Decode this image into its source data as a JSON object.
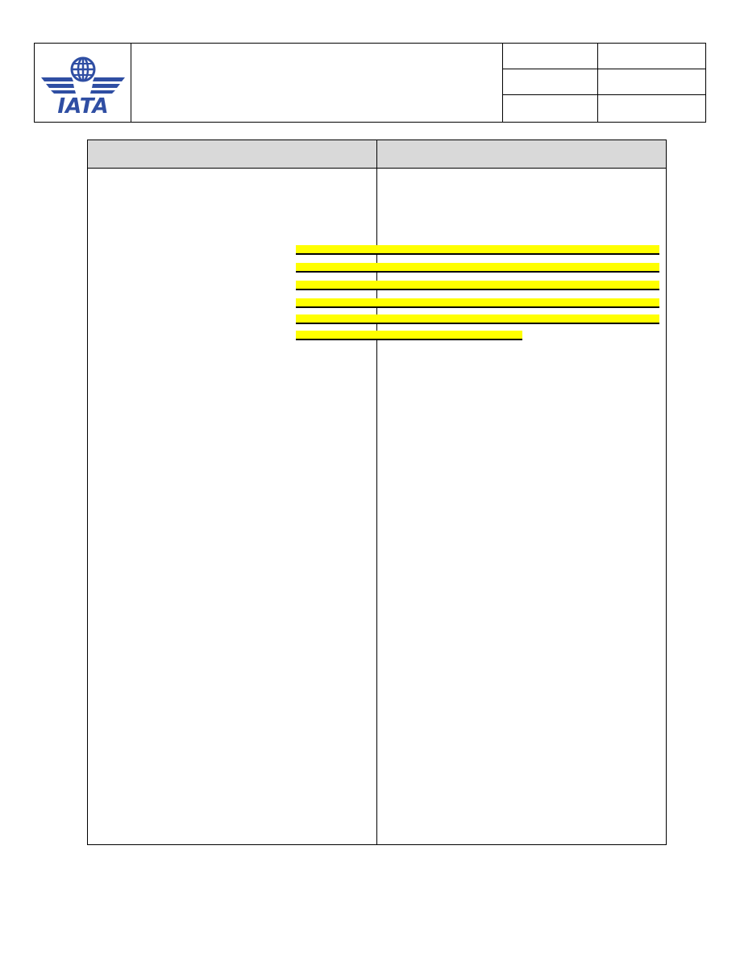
{
  "header": {
    "logo_text": "IATA",
    "title": "",
    "meta": [
      {
        "label": "",
        "value": ""
      },
      {
        "label": "",
        "value": ""
      },
      {
        "label": "",
        "value": ""
      }
    ]
  },
  "table": {
    "left_heading": "",
    "right_heading": "",
    "left_body": "",
    "right_body": "",
    "highlighted_lines": [
      "",
      "",
      "",
      "",
      "",
      "",
      ""
    ]
  },
  "colors": {
    "brand_blue": "#2f4ea3",
    "highlight": "#ffff00",
    "header_fill": "#d9d9d9"
  }
}
